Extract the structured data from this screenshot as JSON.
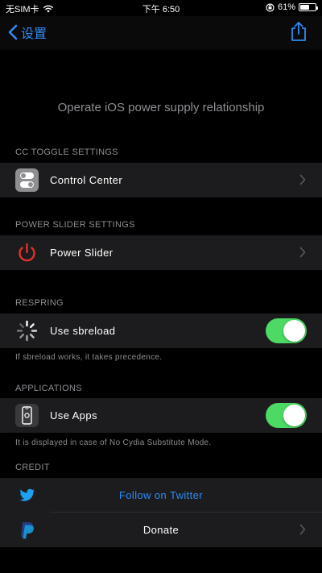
{
  "status_bar": {
    "carrier": "无SIM卡",
    "time": "下午 6:50",
    "battery_percent": "61%",
    "battery_level": 0.61
  },
  "nav": {
    "back_label": "设置"
  },
  "header": {
    "title": "Operate iOS power supply relationship"
  },
  "sections": {
    "cc_toggle": {
      "header": "CC TOGGLE SETTINGS",
      "row_label": "Control Center"
    },
    "power_slider": {
      "header": "POWER SLIDER SETTINGS",
      "row_label": "Power Slider"
    },
    "respring": {
      "header": "RESPRING",
      "row_label": "Use sbreload",
      "toggle_on": true,
      "footer": "If sbreload works, it takes precedence."
    },
    "applications": {
      "header": "APPLICATIONS",
      "row_label": "Use Apps",
      "toggle_on": true,
      "footer": "It is displayed in case of No Cydia Substitute Mode."
    },
    "credit": {
      "header": "CREDIT",
      "twitter_label": "Follow on Twitter",
      "donate_label": "Donate"
    }
  },
  "colors": {
    "accent_blue": "#2f8bf5",
    "toggle_green": "#4cd964",
    "power_red": "#e0322a",
    "twitter_blue": "#1da1f2",
    "paypal_blue": "#253b80"
  },
  "icons": {
    "cc_toggle": "toggle-switch-icon",
    "power": "power-icon",
    "respring": "spinner-icon",
    "applications": "phone-apps-icon",
    "twitter": "twitter-bird-icon",
    "donate": "paypal-icon"
  }
}
